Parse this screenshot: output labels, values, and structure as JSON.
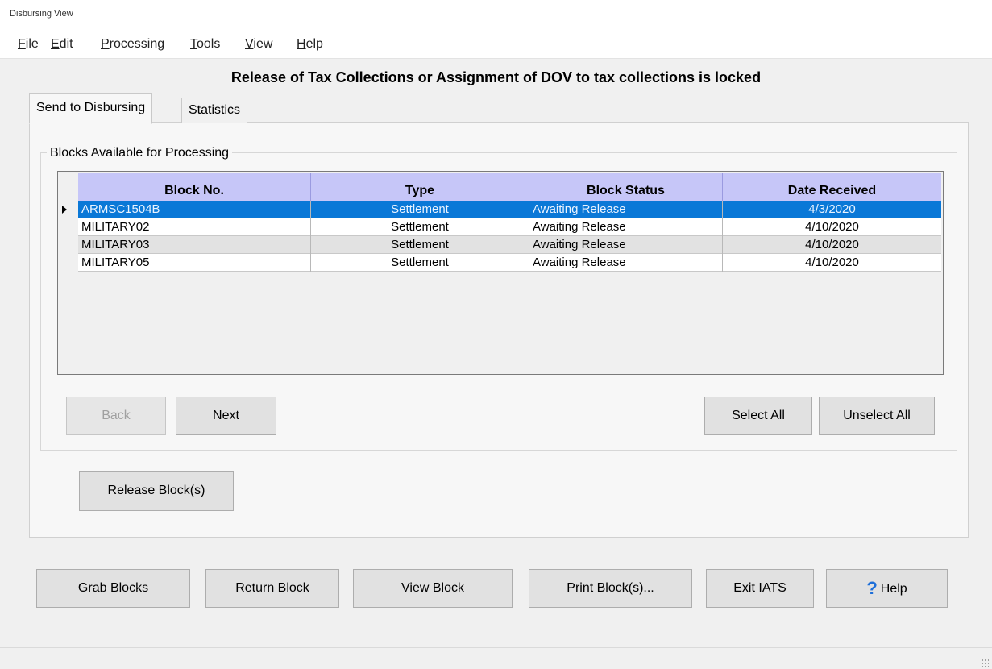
{
  "window": {
    "title": "Disbursing View"
  },
  "menu": [
    {
      "key": "file",
      "label": "File",
      "mnemonic": "F"
    },
    {
      "key": "edit",
      "label": "Edit",
      "mnemonic": "E"
    },
    {
      "key": "processing",
      "label": "Processing",
      "mnemonic": "P"
    },
    {
      "key": "tools",
      "label": "Tools",
      "mnemonic": "T"
    },
    {
      "key": "view",
      "label": "View",
      "mnemonic": "V"
    },
    {
      "key": "help",
      "label": "Help",
      "mnemonic": "H"
    }
  ],
  "lock_message": "Release of Tax Collections or Assignment of DOV to tax collections is locked",
  "tabs": [
    {
      "label": "Send to Disbursing",
      "active": true
    },
    {
      "label": "Statistics",
      "active": false
    }
  ],
  "group": {
    "label": "Blocks Available for Processing"
  },
  "table": {
    "columns": [
      "Block No.",
      "Type",
      "Block Status",
      "Date Received"
    ],
    "rows": [
      {
        "block_no": "ARMSC1504B",
        "type": "Settlement",
        "status": "Awaiting Release",
        "date": "4/3/2020",
        "selected": true
      },
      {
        "block_no": "MILITARY02",
        "type": "Settlement",
        "status": "Awaiting Release",
        "date": "4/10/2020",
        "selected": false
      },
      {
        "block_no": "MILITARY03",
        "type": "Settlement",
        "status": "Awaiting Release",
        "date": "4/10/2020",
        "selected": false
      },
      {
        "block_no": "MILITARY05",
        "type": "Settlement",
        "status": "Awaiting Release",
        "date": "4/10/2020",
        "selected": false
      }
    ]
  },
  "nav": {
    "back_label": "Back",
    "back_enabled": false,
    "next_label": "Next",
    "select_all_label": "Select All",
    "unselect_all_label": "Unselect All"
  },
  "release_label": "Release Block(s)",
  "footer": {
    "grab_label": "Grab Blocks",
    "return_label": "Return Block",
    "view_label": "View Block",
    "print_label": "Print Block(s)...",
    "exit_label": "Exit IATS",
    "help_label": "Help",
    "help_icon": "?"
  },
  "colors": {
    "header_bg": "#c6c6f8",
    "selected_row_bg": "#0a78d7",
    "help_icon": "#1e6fd9"
  }
}
